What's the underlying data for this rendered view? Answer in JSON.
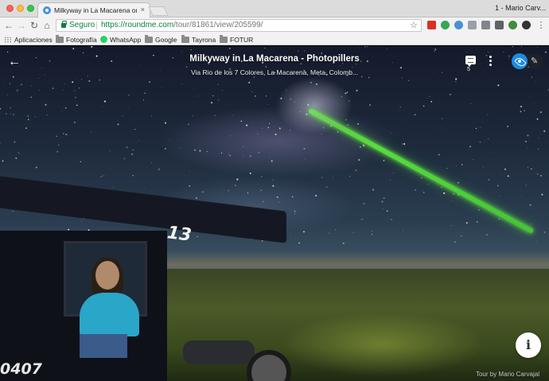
{
  "browser": {
    "tab_title": "Milkyway in La Macarena on Ro",
    "tab_close": "×",
    "user_label": "1 - Mario Carv...",
    "secure_label": "Seguro",
    "url_host": "https://roundme.com",
    "url_path": "/tour/81861/view/205599/",
    "star_glyph": "☆",
    "nav_glyphs": {
      "back": "←",
      "forward": "→",
      "reload": "↻",
      "home": "⌂"
    }
  },
  "bookmarks": [
    {
      "label": "Aplicaciones",
      "icon": "apps-icon"
    },
    {
      "label": "Fotografía",
      "icon": "folder-icon"
    },
    {
      "label": "WhatsApp",
      "icon": "whatsapp-icon"
    },
    {
      "label": "Google",
      "icon": "folder-icon"
    },
    {
      "label": "Tayrona",
      "icon": "folder-icon"
    },
    {
      "label": "FOTUR",
      "icon": "folder-icon"
    }
  ],
  "extensions": [
    {
      "name": "gmail-ext-icon",
      "color": "#d93025"
    },
    {
      "name": "green-ext-icon",
      "color": "#34a853"
    },
    {
      "name": "w-ext-icon",
      "color": "#4a90d9"
    },
    {
      "name": "dropbox-ext-icon",
      "color": "#9aa0a6"
    },
    {
      "name": "cast-ext-icon",
      "color": "#80868b"
    },
    {
      "name": "pulse-ext-icon",
      "color": "#5f6368"
    },
    {
      "name": "globe-ext-icon",
      "color": "#3c8d3c"
    },
    {
      "name": "profile-ext-icon",
      "color": "#333333"
    }
  ],
  "viewer": {
    "title": "Milkyway in La Macarena - Photopillers",
    "subtitle": "Via Rio de los 7 Colores, La Macarena, Meta, Colomb...",
    "back_glyph": "←",
    "comments_count": "5",
    "edit_glyph": "✎",
    "info_glyph": "i",
    "credit_prefix": "Tour by",
    "credit_author": "Mario Carvajal",
    "tuktuk_number": "13",
    "plate_number": "0407",
    "accent_color": "#1e8be0",
    "laser_color": "#5ee83c"
  }
}
